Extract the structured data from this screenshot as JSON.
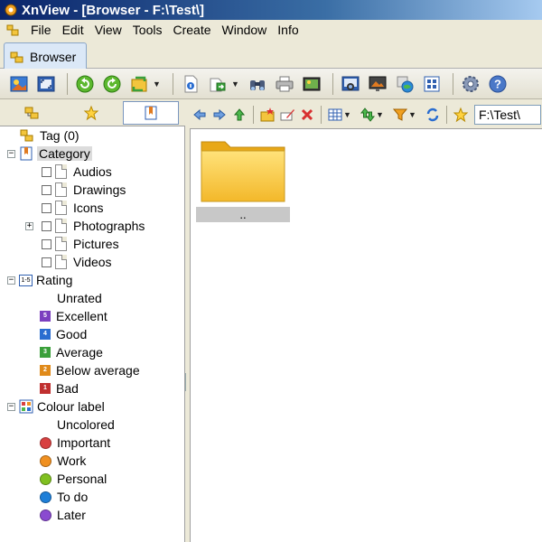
{
  "window": {
    "title": "XnView - [Browser - F:\\Test\\]"
  },
  "menu": {
    "items": [
      "File",
      "Edit",
      "View",
      "Tools",
      "Create",
      "Window",
      "Info"
    ]
  },
  "tabs": {
    "browser_label": "Browser"
  },
  "address": {
    "path": "F:\\Test\\"
  },
  "tree": {
    "tag_label": "Tag (0)",
    "category_label": "Category",
    "categories": [
      "Audios",
      "Drawings",
      "Icons",
      "Photographs",
      "Pictures",
      "Videos"
    ],
    "rating_label": "Rating",
    "ratings": [
      {
        "label": "Unrated",
        "num": "",
        "color": ""
      },
      {
        "label": "Excellent",
        "num": "5",
        "color": "#7b3fbf"
      },
      {
        "label": "Good",
        "num": "4",
        "color": "#2a6dd0"
      },
      {
        "label": "Average",
        "num": "3",
        "color": "#3aa03a"
      },
      {
        "label": "Below average",
        "num": "2",
        "color": "#e08a1a"
      },
      {
        "label": "Bad",
        "num": "1",
        "color": "#c03030"
      }
    ],
    "colour_label": "Colour label",
    "colours": [
      {
        "label": "Uncolored",
        "color": ""
      },
      {
        "label": "Important",
        "color": "#d84040"
      },
      {
        "label": "Work",
        "color": "#f09020"
      },
      {
        "label": "Personal",
        "color": "#80c020"
      },
      {
        "label": "To do",
        "color": "#1e7fd8"
      },
      {
        "label": "Later",
        "color": "#8a4ad0"
      }
    ]
  },
  "content": {
    "parent_folder_label": ".."
  }
}
